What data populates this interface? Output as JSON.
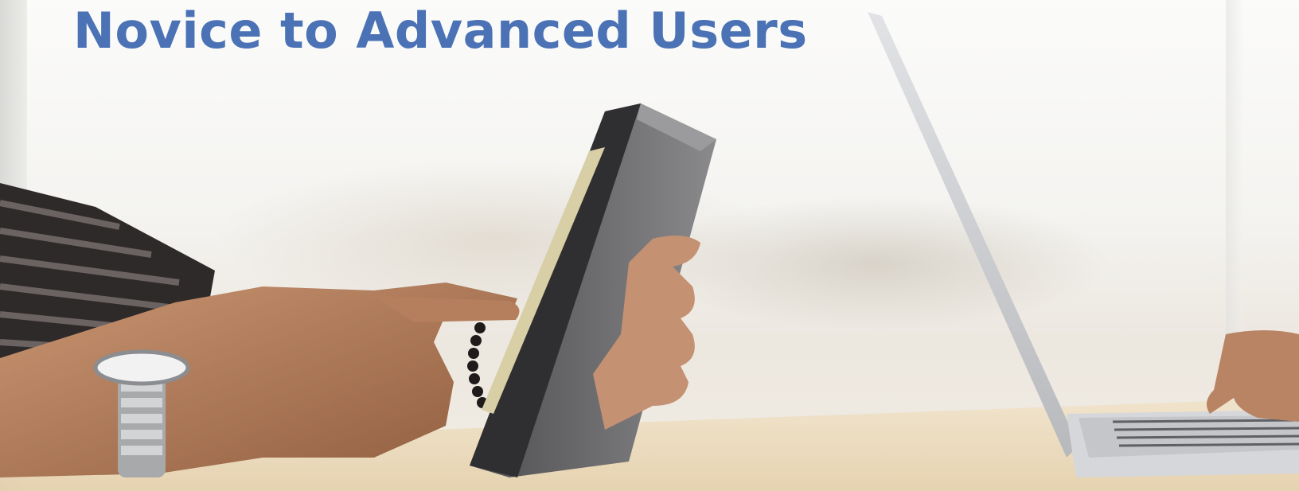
{
  "hero": {
    "headline": "Novice to Advanced Users",
    "headline_color": "#4a72b5"
  },
  "photo": {
    "subjects": [
      "left-arm-with-watch",
      "tablet-in-case",
      "right-hand",
      "laptop",
      "typing-hand",
      "table"
    ]
  }
}
